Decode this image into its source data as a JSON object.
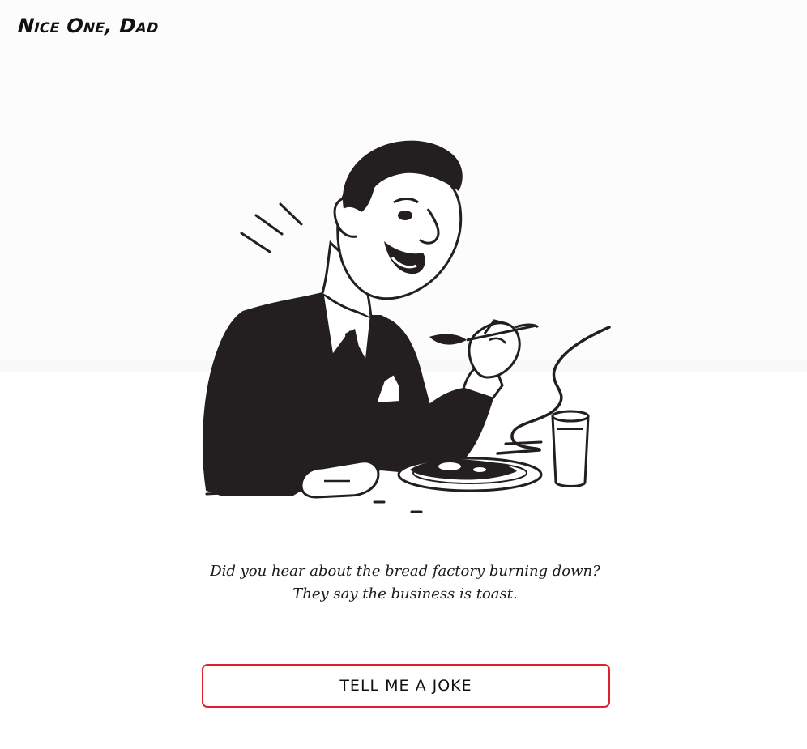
{
  "brand": {
    "logo_text": "Nice One, Dad"
  },
  "illustration": {
    "icon": "man-eating-toast-illustration"
  },
  "joke": {
    "text": "Did you hear about the bread factory burning down? They say the business is toast."
  },
  "actions": {
    "tell_joke_label": "TELL ME A JOKE"
  },
  "colors": {
    "accent": "#e0202e",
    "ink": "#231f20",
    "background": "#ffffff",
    "background_top": "#fcfcfc"
  }
}
